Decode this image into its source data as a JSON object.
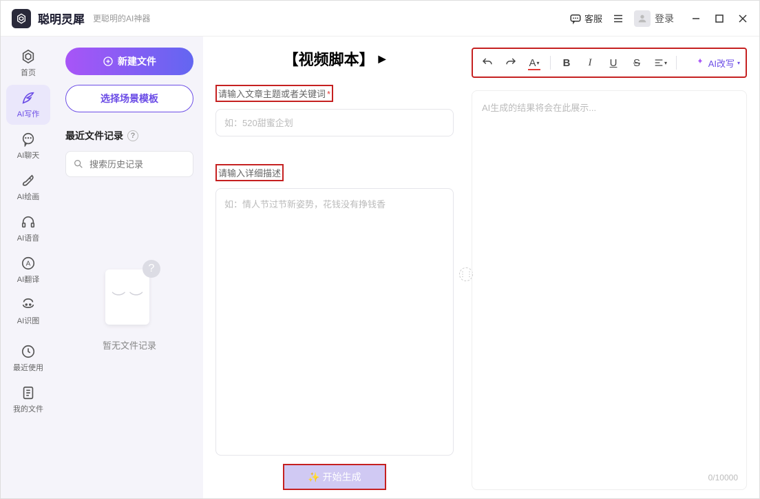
{
  "titlebar": {
    "app_name": "聪明灵犀",
    "subtitle": "更聪明的AI神器",
    "customer_service": "客服",
    "login": "登录"
  },
  "sidebar": {
    "items": [
      {
        "label": "首页"
      },
      {
        "label": "AI写作"
      },
      {
        "label": "AI聊天"
      },
      {
        "label": "AI绘画"
      },
      {
        "label": "AI语音"
      },
      {
        "label": "AI翻译"
      },
      {
        "label": "AI识图"
      },
      {
        "label": "最近使用"
      },
      {
        "label": "我的文件"
      }
    ],
    "active_index": 1
  },
  "leftpanel": {
    "new_file": "新建文件",
    "select_scene": "选择场景模板",
    "recent_header": "最近文件记录",
    "search_placeholder": "搜索历史记录",
    "empty_text": "暂无文件记录"
  },
  "center": {
    "title": "【视频脚本】",
    "topic_label": "请输入文章主题或者关键词",
    "topic_placeholder": "如：520甜蜜企划",
    "desc_label": "请输入详细描述",
    "desc_placeholder": "如：情人节过节新姿势，花钱没有挣钱香",
    "generate_btn": "✨ 开始生成"
  },
  "right": {
    "ai_rewrite": "AI改写",
    "result_placeholder": "AI生成的结果将会在此展示...",
    "char_count": "0/10000"
  }
}
